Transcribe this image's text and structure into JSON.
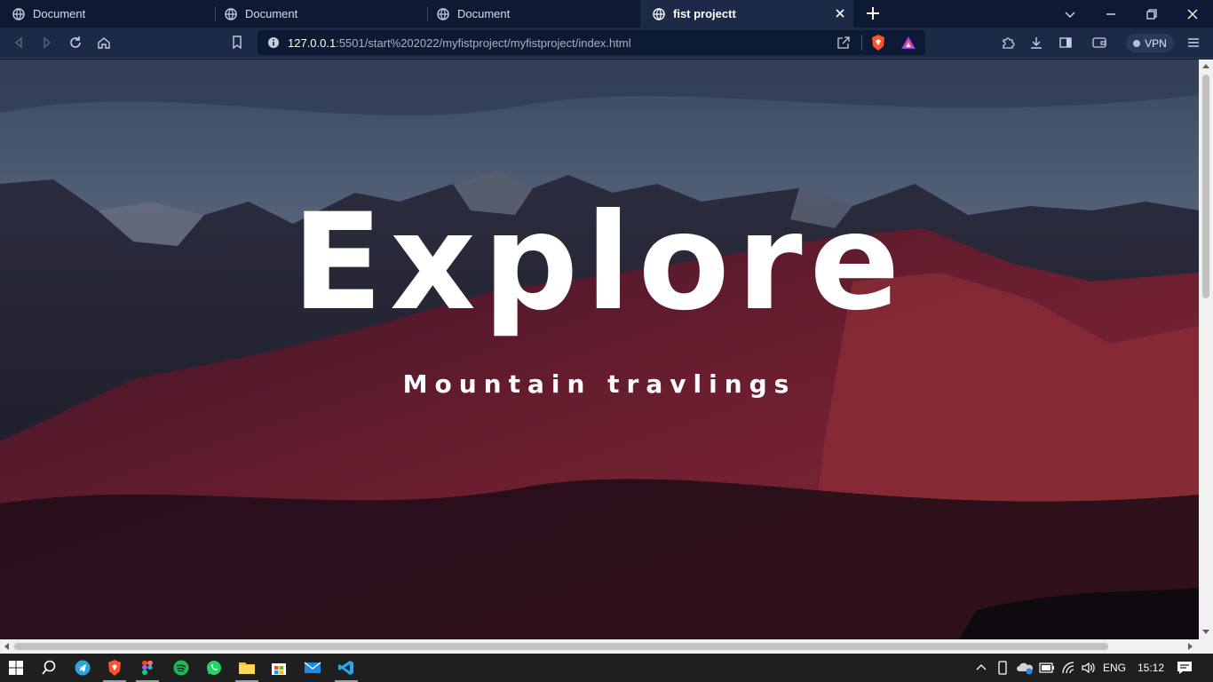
{
  "browser": {
    "tabs": [
      {
        "title": "Document",
        "active": false,
        "icon": "globe-icon"
      },
      {
        "title": "Document",
        "active": false,
        "icon": "globe-icon"
      },
      {
        "title": "Document",
        "active": false,
        "icon": "globe-icon"
      },
      {
        "title": "fist projectt",
        "active": true,
        "icon": "globe-icon"
      }
    ],
    "url": {
      "host": "127.0.0.1",
      "rest": ":5501/start%202022/myfistproject/myfistproject/index.html"
    },
    "vpn_label": "VPN"
  },
  "page": {
    "title": "Explore",
    "subtitle": "Mountain travlings"
  },
  "taskbar": {
    "apps": [
      "start-button",
      "search-icon",
      "telegram-icon",
      "brave-icon",
      "figma-icon",
      "spotify-icon",
      "whatsapp-icon",
      "file-explorer-icon",
      "microsoft-store-icon",
      "mail-icon",
      "vscode-icon"
    ],
    "language": "ENG",
    "time": "15:12"
  },
  "colors": {
    "tabbar_bg": "#0e1a33",
    "toolbar_bg": "#1c2a47",
    "brave_orange": "#fb542b",
    "taskbar_bg": "#1f1f1f"
  }
}
